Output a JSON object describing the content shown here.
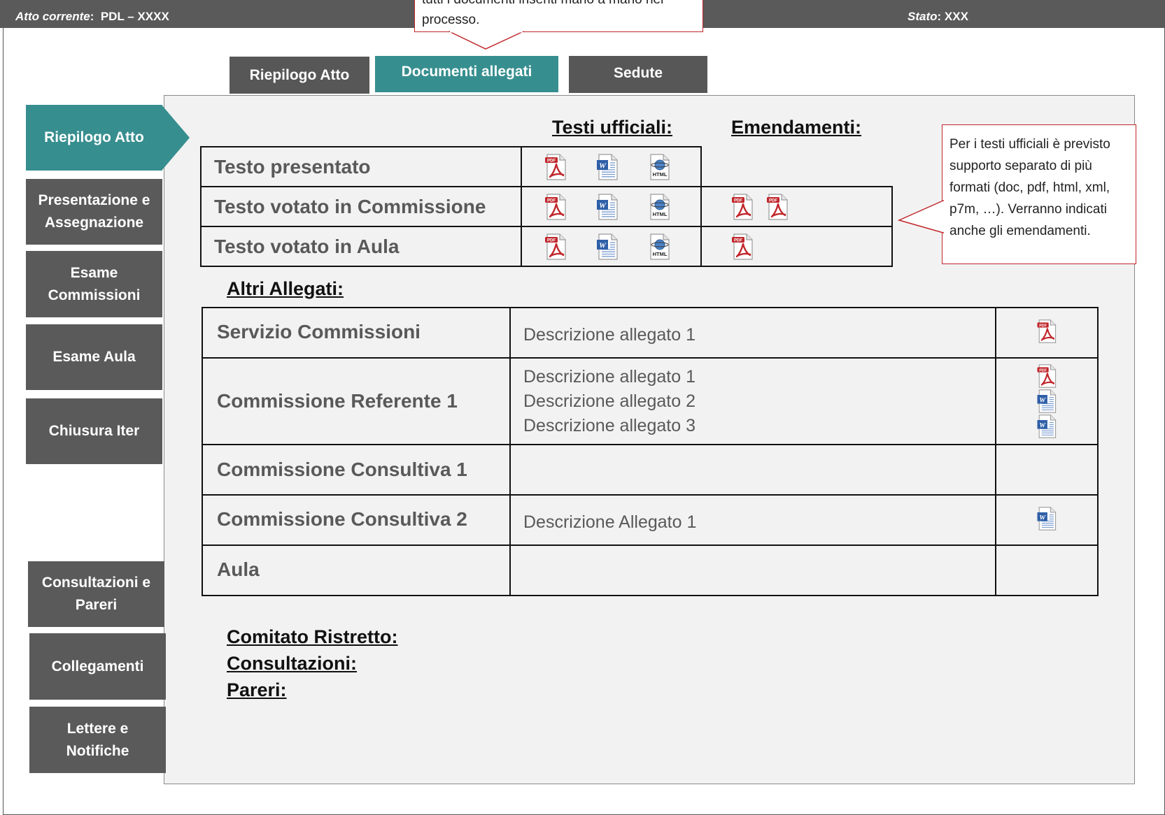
{
  "header": {
    "act_label": "Atto corrente",
    "act_value": "PDL – XXXX",
    "status_label": "Stato",
    "status_value": "XXX"
  },
  "callouts": {
    "top": "tutti i documenti inseriti mano a mano nel processo.",
    "right": "Per i testi ufficiali è previsto supporto separato di più formati (doc, pdf, html, xml, p7m, …). Verranno indicati anche gli emendamenti."
  },
  "tabs": [
    {
      "label": "Riepilogo Atto"
    },
    {
      "label": "Documenti allegati"
    },
    {
      "label": "Sedute"
    }
  ],
  "sidebar": {
    "items": [
      {
        "label": "Riepilogo Atto"
      },
      {
        "label": "Presentazione e Assegnazione"
      },
      {
        "label": "Esame Commissioni"
      },
      {
        "label": "Esame Aula"
      },
      {
        "label": "Chiusura Iter"
      },
      {
        "label": "Consultazioni e Pareri"
      },
      {
        "label": "Collegamenti"
      },
      {
        "label": "Lettere e Notifiche"
      }
    ]
  },
  "official": {
    "heading_texts": "Testi ufficiali:",
    "heading_amend": "Emendamenti:",
    "rows": [
      {
        "label": "Testo presentato",
        "formats": [
          "pdf",
          "doc",
          "html"
        ],
        "amendments": []
      },
      {
        "label": "Testo votato in Commissione",
        "formats": [
          "pdf",
          "doc",
          "html"
        ],
        "amendments": [
          "pdf",
          "pdf"
        ]
      },
      {
        "label": "Testo votato in Aula",
        "formats": [
          "pdf",
          "doc",
          "html"
        ],
        "amendments": [
          "pdf"
        ]
      }
    ]
  },
  "attachments": {
    "heading": "Altri Allegati:",
    "rows": [
      {
        "label": "Servizio Commissioni",
        "descs": [
          "Descrizione allegato 1"
        ],
        "files": [
          "pdf"
        ]
      },
      {
        "label": "Commissione Referente 1",
        "descs": [
          "Descrizione allegato 1",
          "Descrizione allegato 2",
          "Descrizione allegato 3"
        ],
        "files": [
          "pdf",
          "doc",
          "doc"
        ]
      },
      {
        "label": "Commissione Consultiva 1",
        "descs": [],
        "files": []
      },
      {
        "label": "Commissione Consultiva 2",
        "descs": [
          "Descrizione Allegato 1"
        ],
        "files": [
          "doc"
        ]
      },
      {
        "label": "Aula",
        "descs": [],
        "files": []
      }
    ]
  },
  "bottom_headings": {
    "comitato": "Comitato Ristretto:",
    "consultazioni": "Consultazioni:",
    "pareri": "Pareri:"
  },
  "icon_labels": {
    "pdf": "PDF",
    "html": "HTML",
    "doc": "W"
  },
  "colors": {
    "active": "#378e8f",
    "inactive": "#575757",
    "callout_border": "#c0262b",
    "pdf_red": "#c0262b",
    "doc_blue": "#2f5fa8"
  }
}
